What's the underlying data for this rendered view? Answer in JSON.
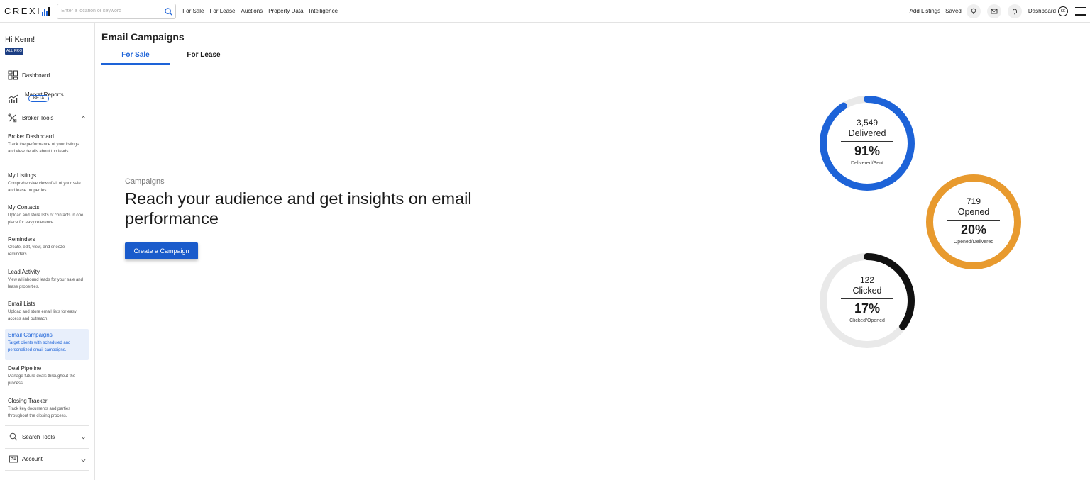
{
  "header": {
    "logo_text": "CREXI",
    "search_placeholder": "Enter a location or keyword",
    "nav": [
      "For Sale",
      "For Lease",
      "Auctions",
      "Property Data",
      "Intelligence"
    ],
    "add_listings": "Add Listings",
    "saved": "Saved",
    "dashboard": "Dashboard",
    "avatar_initials": "KE",
    "icons": [
      "lightbulb-icon",
      "mail-icon",
      "bell-icon",
      "hamburger-menu-icon"
    ]
  },
  "sidebar": {
    "greeting": "Hi Kenn!",
    "badge": "ALL PRO",
    "dashboard": "Dashboard",
    "market_reports": "Market Reports",
    "beta": "BETA",
    "broker_tools": "Broker Tools",
    "tools": [
      {
        "title": "Broker Dashboard",
        "desc": "Track the performance of your listings and view details about top leads."
      },
      {
        "title": "My Listings",
        "desc": "Comprehensive view of all of your sale and lease properties."
      },
      {
        "title": "My Contacts",
        "desc": "Upload and store lists of contacts in one place for easy reference."
      },
      {
        "title": "Reminders",
        "desc": "Create, edit, view, and snooze reminders."
      },
      {
        "title": "Lead Activity",
        "desc": "View all inbound leads for your sale and lease properties."
      },
      {
        "title": "Email Lists",
        "desc": "Upload and store email lists for easy access and outreach."
      },
      {
        "title": "Email Campaigns",
        "desc": "Target clients with scheduled and personalized email campaigns."
      },
      {
        "title": "Deal Pipeline",
        "desc": "Manage future deals throughout the process."
      },
      {
        "title": "Closing Tracker",
        "desc": "Track key documents and parties throughout the closing process."
      }
    ],
    "search_tools": "Search Tools",
    "account": "Account"
  },
  "main": {
    "title": "Email Campaigns",
    "tabs": [
      "For Sale",
      "For Lease"
    ],
    "active_tab": "For Sale",
    "eyebrow": "Campaigns",
    "headline": "Reach your audience and get insights on email performance",
    "cta": "Create a Campaign"
  },
  "stats": [
    {
      "count": "3,549",
      "label": "Delivered",
      "percent": "91%",
      "sub": "Delivered/Sent",
      "fraction": 0.91,
      "color": "#1d63d8"
    },
    {
      "count": "719",
      "label": "Opened",
      "percent": "20%",
      "sub": "Opened/Delivered",
      "fraction": 1.0,
      "color": "#e89a2e"
    },
    {
      "count": "122",
      "label": "Clicked",
      "percent": "17%",
      "sub": "Clicked/Opened",
      "fraction": 0.35,
      "color": "#111111"
    }
  ],
  "colors": {
    "accent": "#1d63d8",
    "ring_track": "#e9e9e9",
    "pro_badge": "#1c3e83"
  }
}
